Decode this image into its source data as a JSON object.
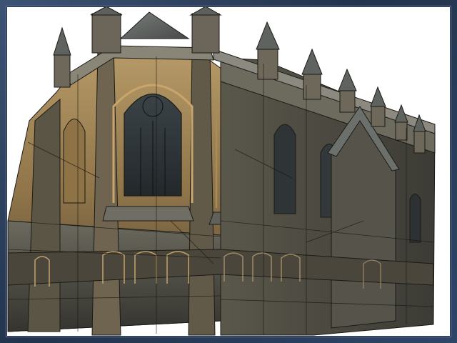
{
  "scene": {
    "subject": "gothic-cathedral-3d-model",
    "render_style": "textured-with-wireframe-overlay",
    "colors": {
      "frame": "#2b3f5c",
      "background": "#ffffff",
      "stone_warm": "#a08458",
      "stone_cool": "#4a4a42",
      "roof": "#5e6260",
      "window": "#2e3438",
      "wire": "#1b1a16"
    }
  }
}
